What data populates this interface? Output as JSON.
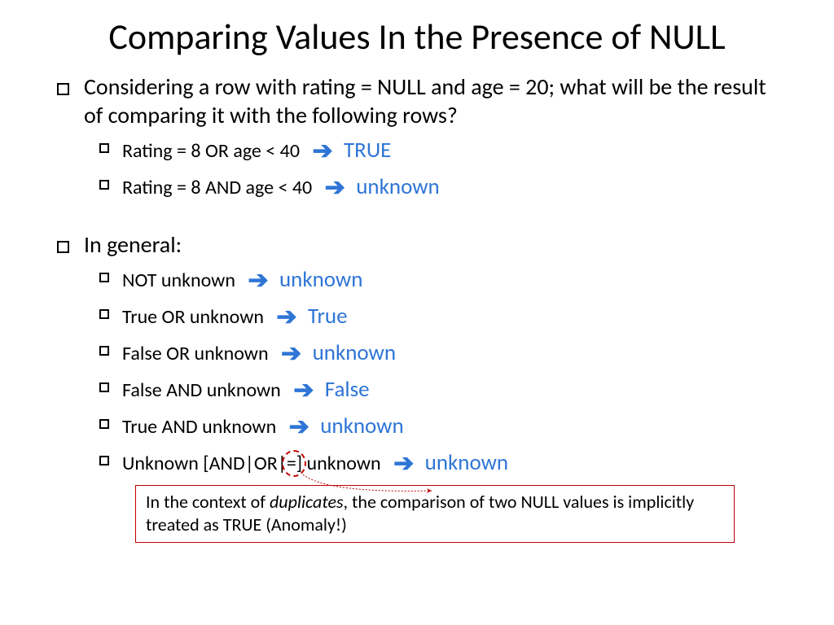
{
  "title": "Comparing Values In the Presence of NULL",
  "intro": "Considering a row with rating = NULL and age = 20; what will be the result of comparing it with the following rows?",
  "ex1_expr": "Rating = 8 OR age < 40",
  "ex1_res": "TRUE",
  "ex2_expr": "Rating = 8 AND age < 40",
  "ex2_res": "unknown",
  "general_heading": "In general:",
  "g1_expr": "NOT unknown",
  "g1_res": "unknown",
  "g2_expr": "True OR unknown",
  "g2_res": "True",
  "g3_expr": "False OR unknown",
  "g3_res": "unknown",
  "g4_expr": "False AND unknown",
  "g4_res": "False",
  "g5_expr": "True AND unknown",
  "g5_res": "unknown",
  "g6_pre": "Unknown [AND|OR|",
  "g6_eq": "=",
  "g6_post": "] unknown",
  "g6_res": "unknown",
  "note_pre": "In the context of ",
  "note_it": "duplicates",
  "note_post": ", the comparison of two NULL values is implicitly treated as TRUE (Anomaly!)"
}
